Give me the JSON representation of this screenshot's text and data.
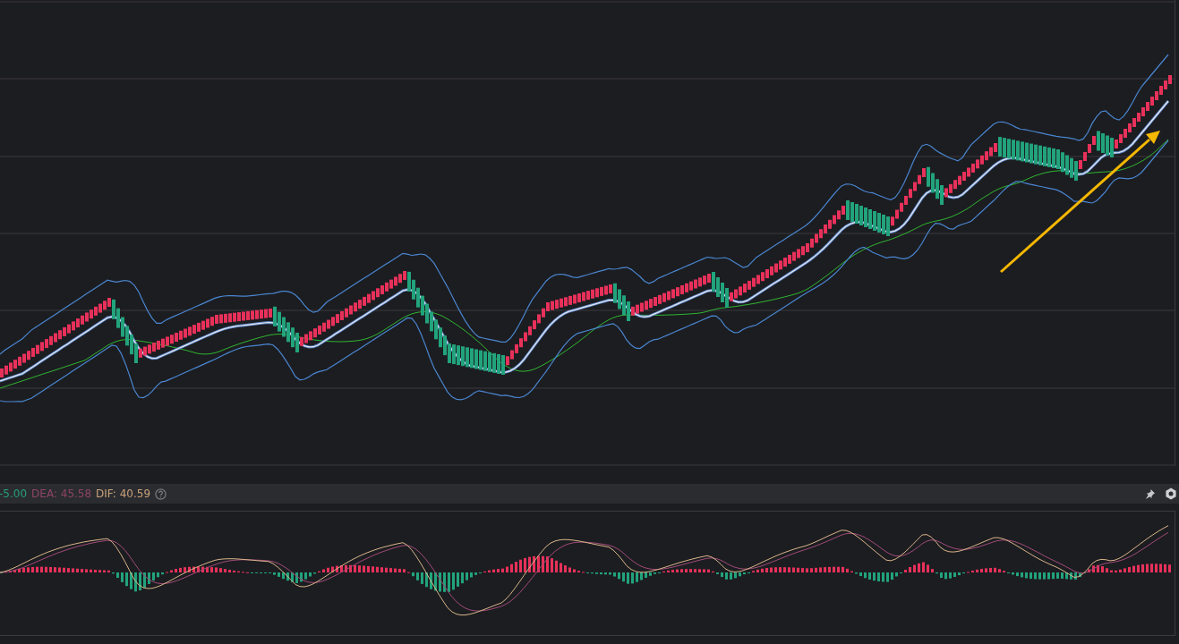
{
  "indicator_legend": [
    {
      "text": "-5.00",
      "color": "#26a17b"
    },
    {
      "text": "DEA: 45.58",
      "color": "#8e4466"
    },
    {
      "text": "DIF: 40.59",
      "color": "#c8a27a"
    }
  ]
}
